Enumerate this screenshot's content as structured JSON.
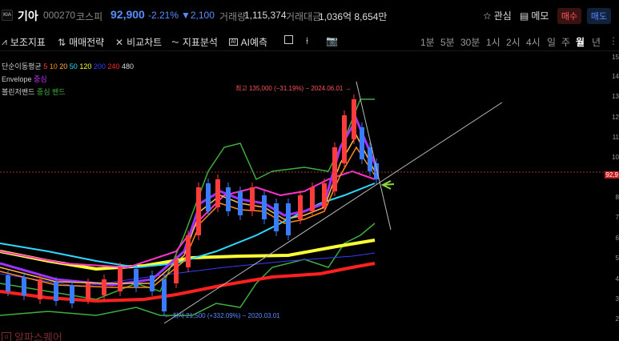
{
  "header": {
    "logo_text": "KIA",
    "name": "기아",
    "code": "000270",
    "market": "코스피",
    "price": "92,900",
    "change_pct": "-2.21%",
    "change_abs": "▼2,100",
    "volume_label": "거래량",
    "volume": "1,115,374",
    "amount_label": "거래대금",
    "amount": "1,036억 8,654만",
    "fav_label": "관심",
    "memo_label": "메모",
    "buy_label": "매수",
    "sell_label": "매도"
  },
  "toolbar": {
    "items": [
      {
        "label": "보조지표",
        "icon": "indicator-icon"
      },
      {
        "label": "매매전략",
        "icon": "strategy-icon"
      },
      {
        "label": "비교차트",
        "icon": "compare-icon"
      },
      {
        "label": "지표분석",
        "icon": "analysis-icon"
      },
      {
        "label": "AI예측",
        "icon": "ai-icon"
      }
    ],
    "periods": [
      "1분",
      "5분",
      "30분",
      "1시",
      "2시",
      "4시",
      "일",
      "주",
      "월",
      "년"
    ],
    "active_period": "월"
  },
  "chart": {
    "legend": {
      "ma_label": "단순이동평균",
      "ma_periods": [
        "5",
        "10",
        "20",
        "50",
        "120",
        "200",
        "240",
        "480"
      ],
      "ma_colors": [
        "#ff3b3b",
        "#ff8c1a",
        "#ffb84d",
        "#2fd9ff",
        "#ffff33",
        "#3b3bff",
        "#ff2a2a",
        "#dddddd"
      ],
      "envelope_label": "Envelope",
      "envelope_sub": "중심",
      "bollinger_label": "볼린저밴드",
      "bollinger_sub": "중심 밴드"
    },
    "high_note": "최고 135,000 (−31.19%) − 2024.06.01 →",
    "low_note": "← 최저 21,500 (+332.09%) − 2020.03.01",
    "current_price_tag": "92,9",
    "y_ticks": [
      "15",
      "14",
      "13",
      "12",
      "11",
      "10",
      "9",
      "8",
      "7",
      "6",
      "5",
      "4",
      "3",
      "2"
    ],
    "price_colors": {
      "up": "#ff3b3b",
      "down": "#3b7bff",
      "accent": "#5b8cff"
    }
  },
  "footer": {
    "watermark": "알파스퀘어"
  }
}
